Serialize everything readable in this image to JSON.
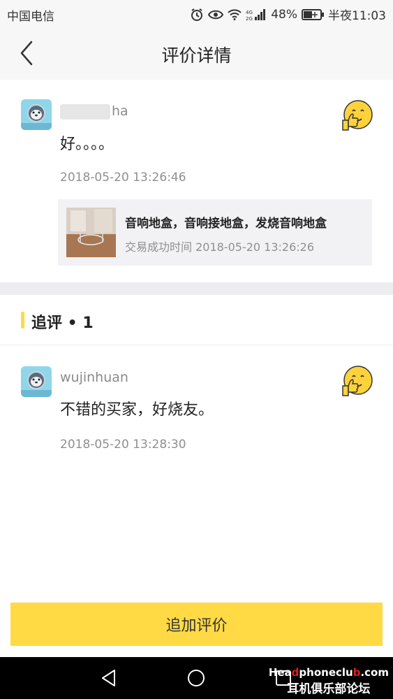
{
  "status_bar": {
    "carrier": "中国电信",
    "network": "4G 2G",
    "battery": "48%",
    "time": "半夜11:03",
    "icons": [
      "alarm-icon",
      "eye-icon",
      "wifi-icon",
      "signal-icon",
      "battery-icon"
    ]
  },
  "nav": {
    "title": "评价详情",
    "back_icon": "chevron-left-icon"
  },
  "review": {
    "username_visible": "ha",
    "content": "好。。。。",
    "time": "2018-05-20 13:26:46",
    "emoji": "thumbs-up-smile-icon",
    "product": {
      "name": "音响地盒，音响接地盒，发烧音响地盒",
      "trade_time": "交易成功时间 2018-05-20 13:26:26"
    }
  },
  "follow_up": {
    "header_label": "追评 • 1",
    "username": "wujinhuan",
    "content": "不错的买家，好烧友。",
    "time": "2018-05-20 13:28:30",
    "emoji": "thumbs-up-smile-icon"
  },
  "actions": {
    "add_review_label": "追加评价"
  },
  "system_nav": {
    "icons": [
      "back-triangle-icon",
      "home-circle-icon",
      "recents-square-icon"
    ]
  },
  "watermark": {
    "part1": "Hea",
    "part2": "d",
    "part3": "phoneclu",
    "part4": "b",
    "part5": ".com",
    "bottom": "耳机俱乐部论坛"
  },
  "colors": {
    "accent_yellow": "#ffda44",
    "header_bar": "#ffdc3c",
    "background_band": "#ededf0"
  }
}
